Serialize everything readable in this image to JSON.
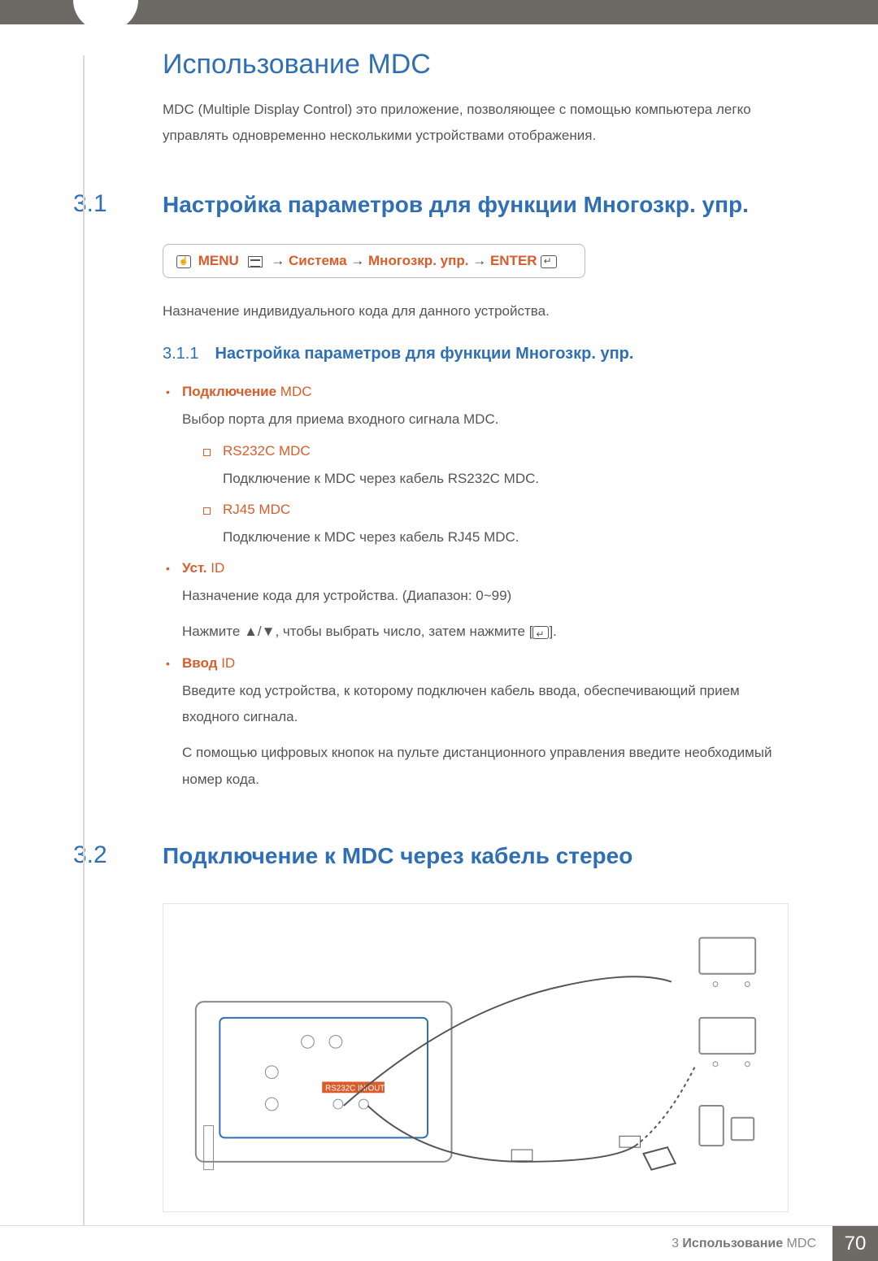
{
  "chapter": {
    "title": "Использование MDC",
    "intro_strong": "MDC (Multiple Display Control)",
    "intro_rest": " это приложение, позволяющее с помощью компьютера легко управлять одновременно несколькими устройствами отображения."
  },
  "section_3_1": {
    "number": "3.1",
    "title": "Настройка параметров для функции Многозкр. упр.",
    "menu_path": {
      "menu": "MENU",
      "arrow": "→",
      "system": "Система",
      "multictl": "Многозкр. упр.",
      "enter": "ENTER"
    },
    "para1": "Назначение индивидуального кода для данного устройства.",
    "sub_3_1_1": {
      "number": "3.1.1",
      "title": "Настройка параметров для функции Многозкр. упр."
    },
    "items": {
      "mdc_conn": {
        "head_bold": "Подключение",
        "head_light": " MDC",
        "desc_pre": "Выбор порта для приема входного сигнала ",
        "desc_mdc": "MDC",
        "desc_post": "."
      },
      "rs232c": {
        "head": "RS232C MDC",
        "desc_pre": "Подключение к ",
        "desc_mdc": "MDC",
        "desc_post": " через кабель RS232C MDC."
      },
      "rj45": {
        "head": "RJ45 MDC",
        "desc_pre": "Подключение к ",
        "desc_mdc": "MDC",
        "desc_post": " через кабель RJ45 MDC."
      },
      "set_id": {
        "head_bold": "Уст.",
        "head_light": " ID",
        "desc1": "Назначение кода для устройства. (Диапазон: 0~99)",
        "desc2_pre": "Нажмите ",
        "desc2_arrows": "▲/▼",
        "desc2_mid": ", чтобы выбрать число, затем нажмите [",
        "desc2_post": "]."
      },
      "enter_id": {
        "head_bold": "Ввод",
        "head_light": " ID",
        "desc1": "Введите код устройства, к которому подключен кабель ввода, обеспечивающий прием входного сигнала.",
        "desc2": "С помощью цифровых кнопок на пульте дистанционного управления введите необходимый номер кода."
      }
    }
  },
  "section_3_2": {
    "number": "3.2",
    "title": "Подключение к MDC через кабель стерео",
    "diagram_label": "RS232C IN/OUT"
  },
  "footer": {
    "chapter_ref_num": "3",
    "chapter_ref_bold": " Использование",
    "chapter_ref_light": " MDC",
    "page_number": "70"
  }
}
